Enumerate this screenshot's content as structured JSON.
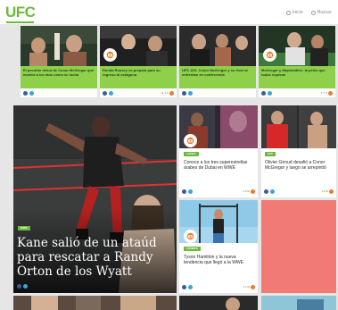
{
  "header": {
    "logo": "UFC",
    "link1": "Inicio",
    "link2": "Buscar"
  },
  "top_cards": [
    {
      "caption": "El peculiar debut de Conor McGregor que mostró a los fans cómo se lucha"
    },
    {
      "caption": "Ronda Rousey se prepara para su regreso al octágono"
    },
    {
      "caption": "UFC 200: Conor McGregor y su rival se enfrentan en conferencia"
    },
    {
      "caption": "McGregor y Mayweather: la pelea que todos esperan"
    }
  ],
  "feature": {
    "tag": "WWE",
    "title": "Kane salió de un ataúd para rescatar a Randy Orton de los Wyatt"
  },
  "mid_cards": [
    {
      "tag": "LUCHA",
      "title": "Conoce a los tres superestrellas árabes de Dubai en WWE",
      "count": "1.6 M"
    },
    {
      "tag": "UFC",
      "title": "Olivier Giroud desafió a Conor McGregor y luego se arrepintió",
      "count": "1.0 M"
    },
    {
      "tag": "FITNESS",
      "title": "Tyson Hamilton y la nueva tendencia que llegó a la WWE",
      "count": "1.1 M"
    }
  ],
  "counts_top": [
    "",
    "11.1 K",
    "",
    "1.7 K"
  ],
  "colors": {
    "accent": "#6cba3c",
    "caption_bg": "#8fd04a",
    "coral": "#f17a74"
  }
}
